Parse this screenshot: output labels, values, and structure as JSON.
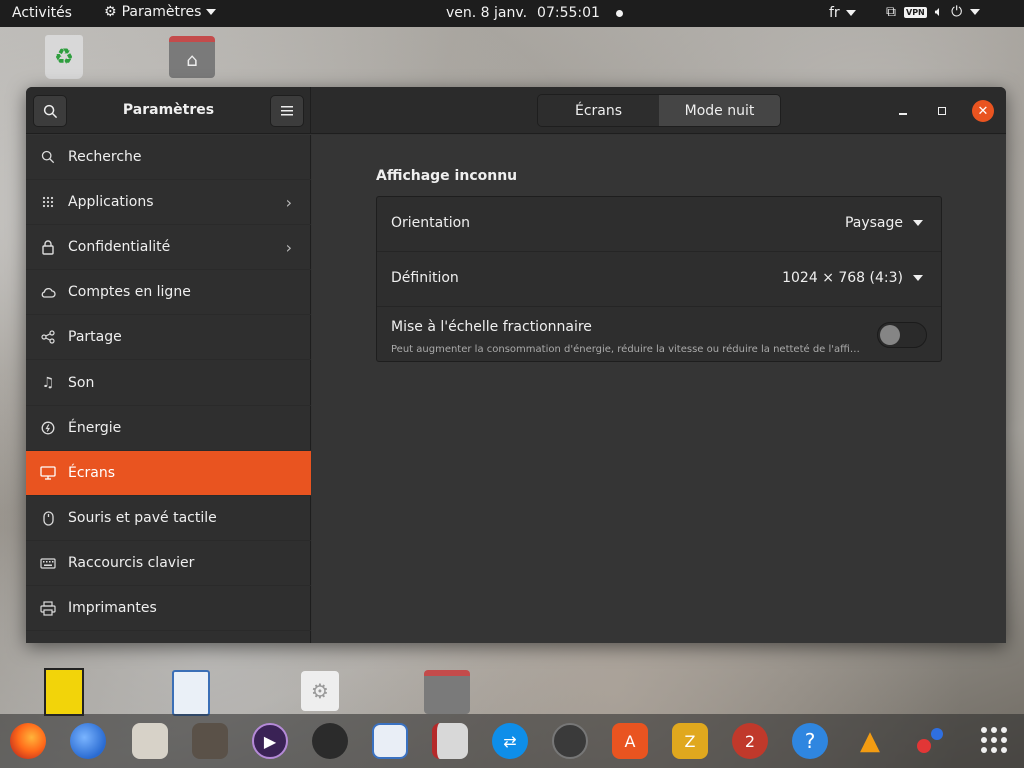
{
  "topbar": {
    "activities": "Activités",
    "app_menu": "Paramètres",
    "date": "ven. 8 janv.",
    "time": "07:55:01",
    "lang": "fr",
    "vpn": "VPN"
  },
  "window": {
    "title": "Paramètres",
    "tabs": [
      {
        "label": "Écrans",
        "active": true
      },
      {
        "label": "Mode nuit",
        "active": false
      }
    ]
  },
  "sidebar": {
    "items": [
      {
        "label": "Recherche",
        "icon": "search-icon",
        "chevron": false
      },
      {
        "label": "Applications",
        "icon": "grid-icon",
        "chevron": true
      },
      {
        "label": "Confidentialité",
        "icon": "lock-icon",
        "chevron": true
      },
      {
        "label": "Comptes en ligne",
        "icon": "cloud-icon",
        "chevron": false
      },
      {
        "label": "Partage",
        "icon": "share-icon",
        "chevron": false
      },
      {
        "label": "Son",
        "icon": "music-note-icon",
        "chevron": false
      },
      {
        "label": "Énergie",
        "icon": "power-icon",
        "chevron": false
      },
      {
        "label": "Écrans",
        "icon": "monitor-icon",
        "chevron": false,
        "active": true
      },
      {
        "label": "Souris et pavé tactile",
        "icon": "mouse-icon",
        "chevron": false
      },
      {
        "label": "Raccourcis clavier",
        "icon": "keyboard-icon",
        "chevron": false
      },
      {
        "label": "Imprimantes",
        "icon": "printer-icon",
        "chevron": false
      }
    ]
  },
  "display": {
    "section_title": "Affichage inconnu",
    "orientation_label": "Orientation",
    "orientation_value": "Paysage",
    "resolution_label": "Définition",
    "resolution_value": "1024 × 768 (4:3)",
    "fractional_label": "Mise à l'échelle fractionnaire",
    "fractional_desc": "Peut augmenter la consommation d'énergie, réduire la vitesse ou réduire la netteté de l'affichage.",
    "fractional_enabled": false
  },
  "colors": {
    "accent": "#e95420",
    "window_bg": "#333333",
    "topbar_bg": "#1d1d1d"
  },
  "dock": {
    "icons": [
      "firefox-icon",
      "thunderbird-icon",
      "files-icon",
      "gimp-icon",
      "media-player-icon",
      "inkscape-icon",
      "writer-icon",
      "reader-icon",
      "teamviewer-icon",
      "clock-icon",
      "software-center-icon",
      "game-icon",
      "chicken-game-icon",
      "help-icon",
      "vlc-icon",
      "dots-app-icon"
    ]
  }
}
